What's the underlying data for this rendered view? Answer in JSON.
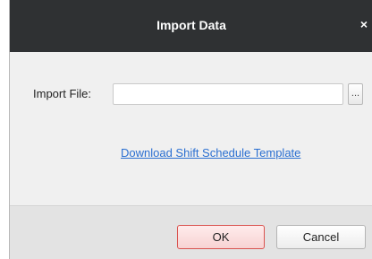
{
  "dialog": {
    "title": "Import Data",
    "close_icon": "close-icon",
    "close_glyph": "×"
  },
  "form": {
    "import_file_label": "Import File:",
    "import_file_value": "",
    "browse_label": "...",
    "template_link": "Download Shift Schedule Template"
  },
  "footer": {
    "ok_label": "OK",
    "cancel_label": "Cancel"
  },
  "colors": {
    "titlebar": "#2f3133",
    "link": "#2a6fd1",
    "ok_border": "#d9534f"
  }
}
